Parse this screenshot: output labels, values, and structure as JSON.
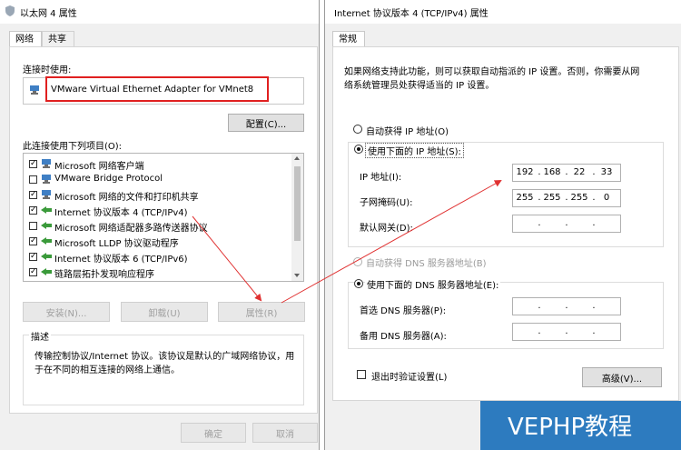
{
  "left_window": {
    "title": "以太网 4 属性",
    "tabs": [
      {
        "label": "网络"
      },
      {
        "label": "共享"
      }
    ],
    "connect_using_label": "连接时使用:",
    "adapter_name": "VMware Virtual Ethernet Adapter for VMnet8",
    "configure_button": "配置(C)...",
    "items_label": "此连接使用下列项目(O):",
    "items": [
      {
        "label": "Microsoft 网络客户端",
        "checked": true
      },
      {
        "label": "VMware Bridge Protocol",
        "checked": false
      },
      {
        "label": "Microsoft 网络的文件和打印机共享",
        "checked": true
      },
      {
        "label": "Internet 协议版本 4 (TCP/IPv4)",
        "checked": true
      },
      {
        "label": "Microsoft 网络适配器多路传送器协议",
        "checked": false
      },
      {
        "label": "Microsoft LLDP 协议驱动程序",
        "checked": true
      },
      {
        "label": "Internet 协议版本 6 (TCP/IPv6)",
        "checked": true
      },
      {
        "label": "链路层拓扑发现响应程序",
        "checked": true
      }
    ],
    "install_button": "安装(N)...",
    "uninstall_button": "卸载(U)",
    "properties_button": "属性(R)",
    "description_label": "描述",
    "description_text_1": "传输控制协议/Internet 协议。该协议是默认的广域网络协议，用",
    "description_text_2": "于在不同的相互连接的网络上通信。",
    "ok_button": "确定",
    "cancel_button": "取消"
  },
  "right_window": {
    "title": "Internet 协议版本 4 (TCP/IPv4) 属性",
    "tabs": [
      {
        "label": "常规"
      }
    ],
    "intro_line_1": "如果网络支持此功能，则可以获取自动指派的 IP 设置。否则，你需要从网",
    "intro_line_2": "络系统管理员处获得适当的 IP 设置。",
    "auto_ip_label": "自动获得 IP 地址(O)",
    "use_ip_label": "使用下面的 IP 地址(S):",
    "ip_address_label": "IP 地址(I):",
    "ip_address": [
      "192",
      "168",
      "22",
      "33"
    ],
    "subnet_label": "子网掩码(U):",
    "subnet": [
      "255",
      "255",
      "255",
      "0"
    ],
    "gateway_label": "默认网关(D):",
    "auto_dns_label": "自动获得 DNS 服务器地址(B)",
    "use_dns_label": "使用下面的 DNS 服务器地址(E):",
    "preferred_dns_label": "首选 DNS 服务器(P):",
    "alternate_dns_label": "备用 DNS 服务器(A):",
    "validate_label": "退出时验证设置(L)",
    "advanced_button": "高级(V)..."
  },
  "watermark": "VEPHP教程",
  "colors": {
    "highlight_red": "#e02020",
    "arrow_red": "#e03030",
    "watermark_bg": "#2d7bbf"
  }
}
